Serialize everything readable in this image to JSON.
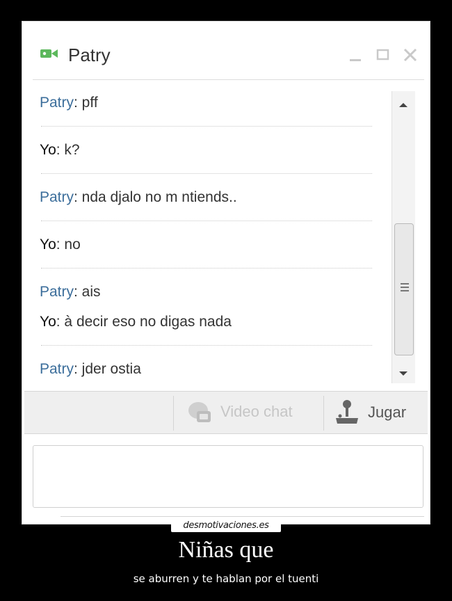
{
  "chat": {
    "title": "Patry",
    "messages": [
      {
        "sender": "Patry",
        "text": ": pff"
      },
      {
        "sender": "Yo",
        "text": ": k?"
      },
      {
        "sender": "Patry",
        "text": ": nda djalo no m ntiends.."
      },
      {
        "sender": "Yo",
        "text": ": no"
      },
      {
        "sender": "Patry",
        "text": ": ais"
      },
      {
        "sender": "Yo",
        "text": ": à decir eso no digas nada"
      },
      {
        "sender": "Patry",
        "text": ": jder ostia"
      }
    ],
    "toolbar": {
      "video_chat_label": "Video chat",
      "jugar_label": "Jugar"
    },
    "input_value": ""
  },
  "poster": {
    "watermark": "desmotivaciones.es",
    "title": "Niñas que",
    "subtitle": "se aburren y te hablan por el tuenti"
  },
  "colors": {
    "sender_patry": "#3c6e9b",
    "sender_yo": "#111111",
    "background": "#000000",
    "video_icon": "#5cb85c"
  },
  "icons": {
    "header": "video-camera-icon",
    "window_controls": [
      "minimize-icon",
      "maximize-icon",
      "close-icon"
    ],
    "scroll": [
      "scroll-up-icon",
      "scroll-down-icon"
    ],
    "video_chat": "webcam-icon",
    "jugar": "joystick-icon"
  }
}
